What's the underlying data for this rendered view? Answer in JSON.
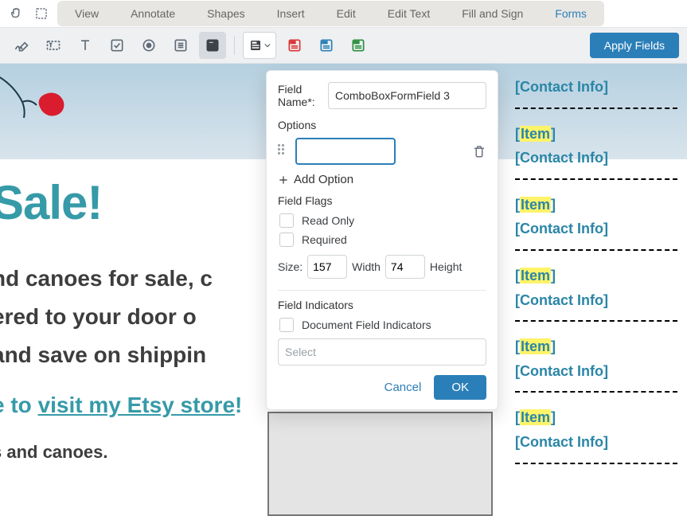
{
  "menu": {
    "tabs": [
      "View",
      "Annotate",
      "Shapes",
      "Insert",
      "Edit",
      "Edit Text",
      "Fill and Sign",
      "Forms"
    ],
    "active": "Forms"
  },
  "toolbar": {
    "apply_label": "Apply Fields"
  },
  "panel": {
    "field_name_label": "Field Name*:",
    "field_name_value": "ComboBoxFormField 3",
    "options_label": "Options",
    "option_value": "",
    "add_option_label": "Add Option",
    "flags_label": "Field Flags",
    "flag_readonly": "Read Only",
    "flag_required": "Required",
    "size_label": "Size:",
    "width_value": "157",
    "width_label": "Width",
    "height_value": "74",
    "height_label": "Height",
    "indicators_label": "Field Indicators",
    "doc_indicators": "Document Field Indicators",
    "select_placeholder": "Select",
    "cancel": "Cancel",
    "ok": "OK"
  },
  "doc": {
    "sale": "Sale!",
    "p1": "nd canoes for sale, c",
    "p2": "ered to your door o",
    "p3": "and save on shippin",
    "link_pre": "e to ",
    "link_text": "visit my Etsy store",
    "link_post": "!",
    "small": "s and canoes."
  },
  "side": {
    "item_label": "Item",
    "contact_label": "Contact Info"
  }
}
